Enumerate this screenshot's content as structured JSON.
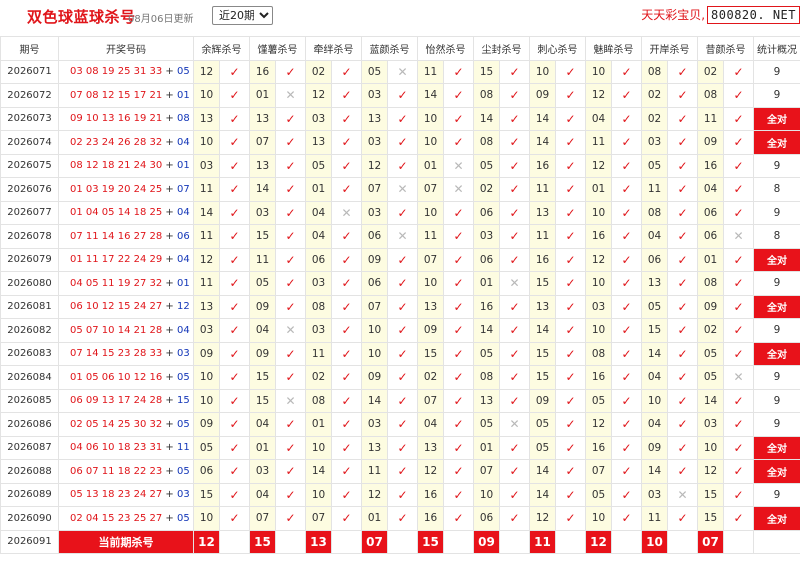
{
  "header": {
    "title": "双色球蓝球杀号",
    "updated": "08月06日更新",
    "range_selected": "近20期",
    "brand_name": "天天彩宝贝,",
    "brand_url": "800820. NET"
  },
  "columns": {
    "period": "期号",
    "numbers": "开奖号码",
    "experts": [
      "余辉杀号",
      "馑薯杀号",
      "牵绊杀号",
      "蓝颜杀号",
      "怡然杀号",
      "尘封杀号",
      "刺心杀号",
      "魅眸杀号",
      "开岸杀号",
      "昔颜杀号"
    ],
    "stat": "统计概况"
  },
  "all_correct_label": "全对",
  "rows": [
    {
      "period": "2026071",
      "reds": "03 08 19 25 31 33",
      "blue": "05",
      "picks": [
        "12",
        "16",
        "02",
        "05",
        "11",
        "15",
        "10",
        "10",
        "08",
        "02"
      ],
      "ok": [
        1,
        1,
        1,
        0,
        1,
        1,
        1,
        1,
        1,
        1
      ],
      "stat": "9"
    },
    {
      "period": "2026072",
      "reds": "07 08 12 15 17 21",
      "blue": "01",
      "picks": [
        "10",
        "01",
        "12",
        "03",
        "14",
        "08",
        "09",
        "12",
        "02",
        "08"
      ],
      "ok": [
        1,
        0,
        1,
        1,
        1,
        1,
        1,
        1,
        1,
        1
      ],
      "stat": "9"
    },
    {
      "period": "2026073",
      "reds": "09 10 13 16 19 21",
      "blue": "08",
      "picks": [
        "13",
        "13",
        "03",
        "13",
        "10",
        "14",
        "14",
        "04",
        "02",
        "11"
      ],
      "ok": [
        1,
        1,
        1,
        1,
        1,
        1,
        1,
        1,
        1,
        1
      ],
      "stat": "全对"
    },
    {
      "period": "2026074",
      "reds": "02 23 24 26 28 32",
      "blue": "04",
      "picks": [
        "10",
        "07",
        "13",
        "03",
        "10",
        "08",
        "14",
        "11",
        "03",
        "09"
      ],
      "ok": [
        1,
        1,
        1,
        1,
        1,
        1,
        1,
        1,
        1,
        1
      ],
      "stat": "全对"
    },
    {
      "period": "2026075",
      "reds": "08 12 18 21 24 30",
      "blue": "01",
      "picks": [
        "03",
        "13",
        "05",
        "12",
        "01",
        "05",
        "16",
        "12",
        "05",
        "16"
      ],
      "ok": [
        1,
        1,
        1,
        1,
        0,
        1,
        1,
        1,
        1,
        1
      ],
      "stat": "9"
    },
    {
      "period": "2026076",
      "reds": "01 03 19 20 24 25",
      "blue": "07",
      "picks": [
        "11",
        "14",
        "01",
        "07",
        "07",
        "02",
        "11",
        "01",
        "11",
        "04"
      ],
      "ok": [
        1,
        1,
        1,
        0,
        0,
        1,
        1,
        1,
        1,
        1
      ],
      "stat": "8"
    },
    {
      "period": "2026077",
      "reds": "01 04 05 14 18 25",
      "blue": "04",
      "picks": [
        "14",
        "03",
        "04",
        "03",
        "10",
        "06",
        "13",
        "10",
        "08",
        "06"
      ],
      "ok": [
        1,
        1,
        0,
        1,
        1,
        1,
        1,
        1,
        1,
        1
      ],
      "stat": "9"
    },
    {
      "period": "2026078",
      "reds": "07 11 14 16 27 28",
      "blue": "06",
      "picks": [
        "11",
        "15",
        "04",
        "06",
        "11",
        "03",
        "11",
        "16",
        "04",
        "06"
      ],
      "ok": [
        1,
        1,
        1,
        0,
        1,
        1,
        1,
        1,
        1,
        0
      ],
      "stat": "8"
    },
    {
      "period": "2026079",
      "reds": "01 11 17 22 24 29",
      "blue": "04",
      "picks": [
        "12",
        "11",
        "06",
        "09",
        "07",
        "06",
        "16",
        "12",
        "06",
        "01"
      ],
      "ok": [
        1,
        1,
        1,
        1,
        1,
        1,
        1,
        1,
        1,
        1
      ],
      "stat": "全对"
    },
    {
      "period": "2026080",
      "reds": "04 05 11 19 27 32",
      "blue": "01",
      "picks": [
        "11",
        "05",
        "03",
        "06",
        "10",
        "01",
        "15",
        "10",
        "13",
        "08"
      ],
      "ok": [
        1,
        1,
        1,
        1,
        1,
        0,
        1,
        1,
        1,
        1
      ],
      "stat": "9"
    },
    {
      "period": "2026081",
      "reds": "06 10 12 15 24 27",
      "blue": "12",
      "picks": [
        "13",
        "09",
        "08",
        "07",
        "13",
        "16",
        "13",
        "03",
        "05",
        "09"
      ],
      "ok": [
        1,
        1,
        1,
        1,
        1,
        1,
        1,
        1,
        1,
        1
      ],
      "stat": "全对"
    },
    {
      "period": "2026082",
      "reds": "05 07 10 14 21 28",
      "blue": "04",
      "picks": [
        "03",
        "04",
        "03",
        "10",
        "09",
        "14",
        "14",
        "10",
        "15",
        "02"
      ],
      "ok": [
        1,
        0,
        1,
        1,
        1,
        1,
        1,
        1,
        1,
        1
      ],
      "stat": "9"
    },
    {
      "period": "2026083",
      "reds": "07 14 15 23 28 33",
      "blue": "03",
      "picks": [
        "09",
        "09",
        "11",
        "10",
        "15",
        "05",
        "15",
        "08",
        "14",
        "05"
      ],
      "ok": [
        1,
        1,
        1,
        1,
        1,
        1,
        1,
        1,
        1,
        1
      ],
      "stat": "全对"
    },
    {
      "period": "2026084",
      "reds": "01 05 06 10 12 16",
      "blue": "05",
      "picks": [
        "10",
        "15",
        "02",
        "09",
        "02",
        "08",
        "15",
        "16",
        "04",
        "05"
      ],
      "ok": [
        1,
        1,
        1,
        1,
        1,
        1,
        1,
        1,
        1,
        0
      ],
      "stat": "9"
    },
    {
      "period": "2026085",
      "reds": "06 09 13 17 24 28",
      "blue": "15",
      "picks": [
        "10",
        "15",
        "08",
        "14",
        "07",
        "13",
        "09",
        "05",
        "10",
        "14"
      ],
      "ok": [
        1,
        0,
        1,
        1,
        1,
        1,
        1,
        1,
        1,
        1
      ],
      "stat": "9"
    },
    {
      "period": "2026086",
      "reds": "02 05 14 25 30 32",
      "blue": "05",
      "picks": [
        "09",
        "04",
        "01",
        "03",
        "04",
        "05",
        "05",
        "12",
        "04",
        "03"
      ],
      "ok": [
        1,
        1,
        1,
        1,
        1,
        0,
        1,
        1,
        1,
        1
      ],
      "stat": "9"
    },
    {
      "period": "2026087",
      "reds": "04 06 10 18 23 31",
      "blue": "11",
      "picks": [
        "05",
        "01",
        "10",
        "13",
        "13",
        "01",
        "05",
        "16",
        "09",
        "10"
      ],
      "ok": [
        1,
        1,
        1,
        1,
        1,
        1,
        1,
        1,
        1,
        1
      ],
      "stat": "全对"
    },
    {
      "period": "2026088",
      "reds": "06 07 11 18 22 23",
      "blue": "05",
      "picks": [
        "06",
        "03",
        "14",
        "11",
        "12",
        "07",
        "14",
        "07",
        "14",
        "12"
      ],
      "ok": [
        1,
        1,
        1,
        1,
        1,
        1,
        1,
        1,
        1,
        1
      ],
      "stat": "全对"
    },
    {
      "period": "2026089",
      "reds": "05 13 18 23 24 27",
      "blue": "03",
      "picks": [
        "15",
        "04",
        "10",
        "12",
        "16",
        "10",
        "14",
        "05",
        "03",
        "15"
      ],
      "ok": [
        1,
        1,
        1,
        1,
        1,
        1,
        1,
        1,
        0,
        1
      ],
      "stat": "9"
    },
    {
      "period": "2026090",
      "reds": "02 04 15 23 25 27",
      "blue": "05",
      "picks": [
        "10",
        "07",
        "07",
        "01",
        "16",
        "06",
        "12",
        "10",
        "11",
        "15"
      ],
      "ok": [
        1,
        1,
        1,
        1,
        1,
        1,
        1,
        1,
        1,
        1
      ],
      "stat": "全对"
    }
  ],
  "current": {
    "period": "2026091",
    "label": "当前期杀号",
    "picks": [
      "12",
      "15",
      "13",
      "07",
      "15",
      "09",
      "11",
      "12",
      "10",
      "07"
    ]
  },
  "icons": {
    "ok": "checkmark-icon",
    "no": "cross-icon"
  },
  "colors": {
    "red": "#e0151a",
    "blue": "#1437b8",
    "value_bg": "#fdfce1",
    "highlight": "#e8121a"
  }
}
